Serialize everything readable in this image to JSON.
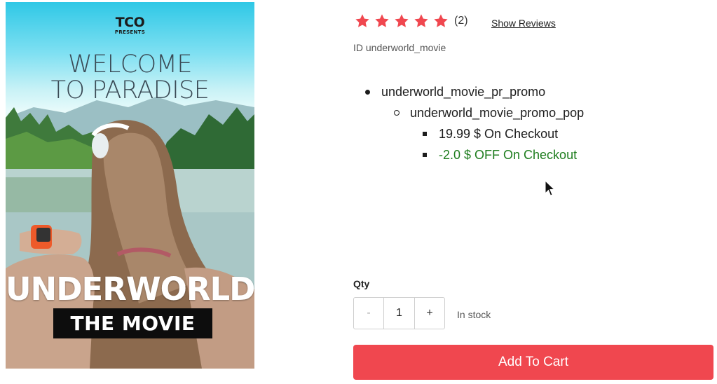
{
  "poster": {
    "logo": "TCO",
    "logo_sub": "PRESENTS",
    "tagline_line1": "WELCOME",
    "tagline_line2": "TO PARADISE",
    "title": "UNDERWORLD",
    "subtitle": "THE MOVIE"
  },
  "rating": {
    "stars": 5,
    "count_text": "(2)",
    "star_color": "#f0474f",
    "show_reviews_label": "Show Reviews"
  },
  "product": {
    "id_text": "ID underworld_movie"
  },
  "promotions": {
    "level1": "underworld_movie_pr_promo",
    "level2": "underworld_movie_promo_pop",
    "price_line": "19.99 $ On Checkout",
    "discount_line": "-2.0 $ OFF On Checkout",
    "discount_color": "#1e7d1e"
  },
  "purchase": {
    "qty_label": "Qty",
    "minus_label": "-",
    "qty_value": "1",
    "plus_label": "+",
    "stock_status": "In stock",
    "add_to_cart_label": "Add To Cart",
    "button_color": "#f0474f"
  }
}
